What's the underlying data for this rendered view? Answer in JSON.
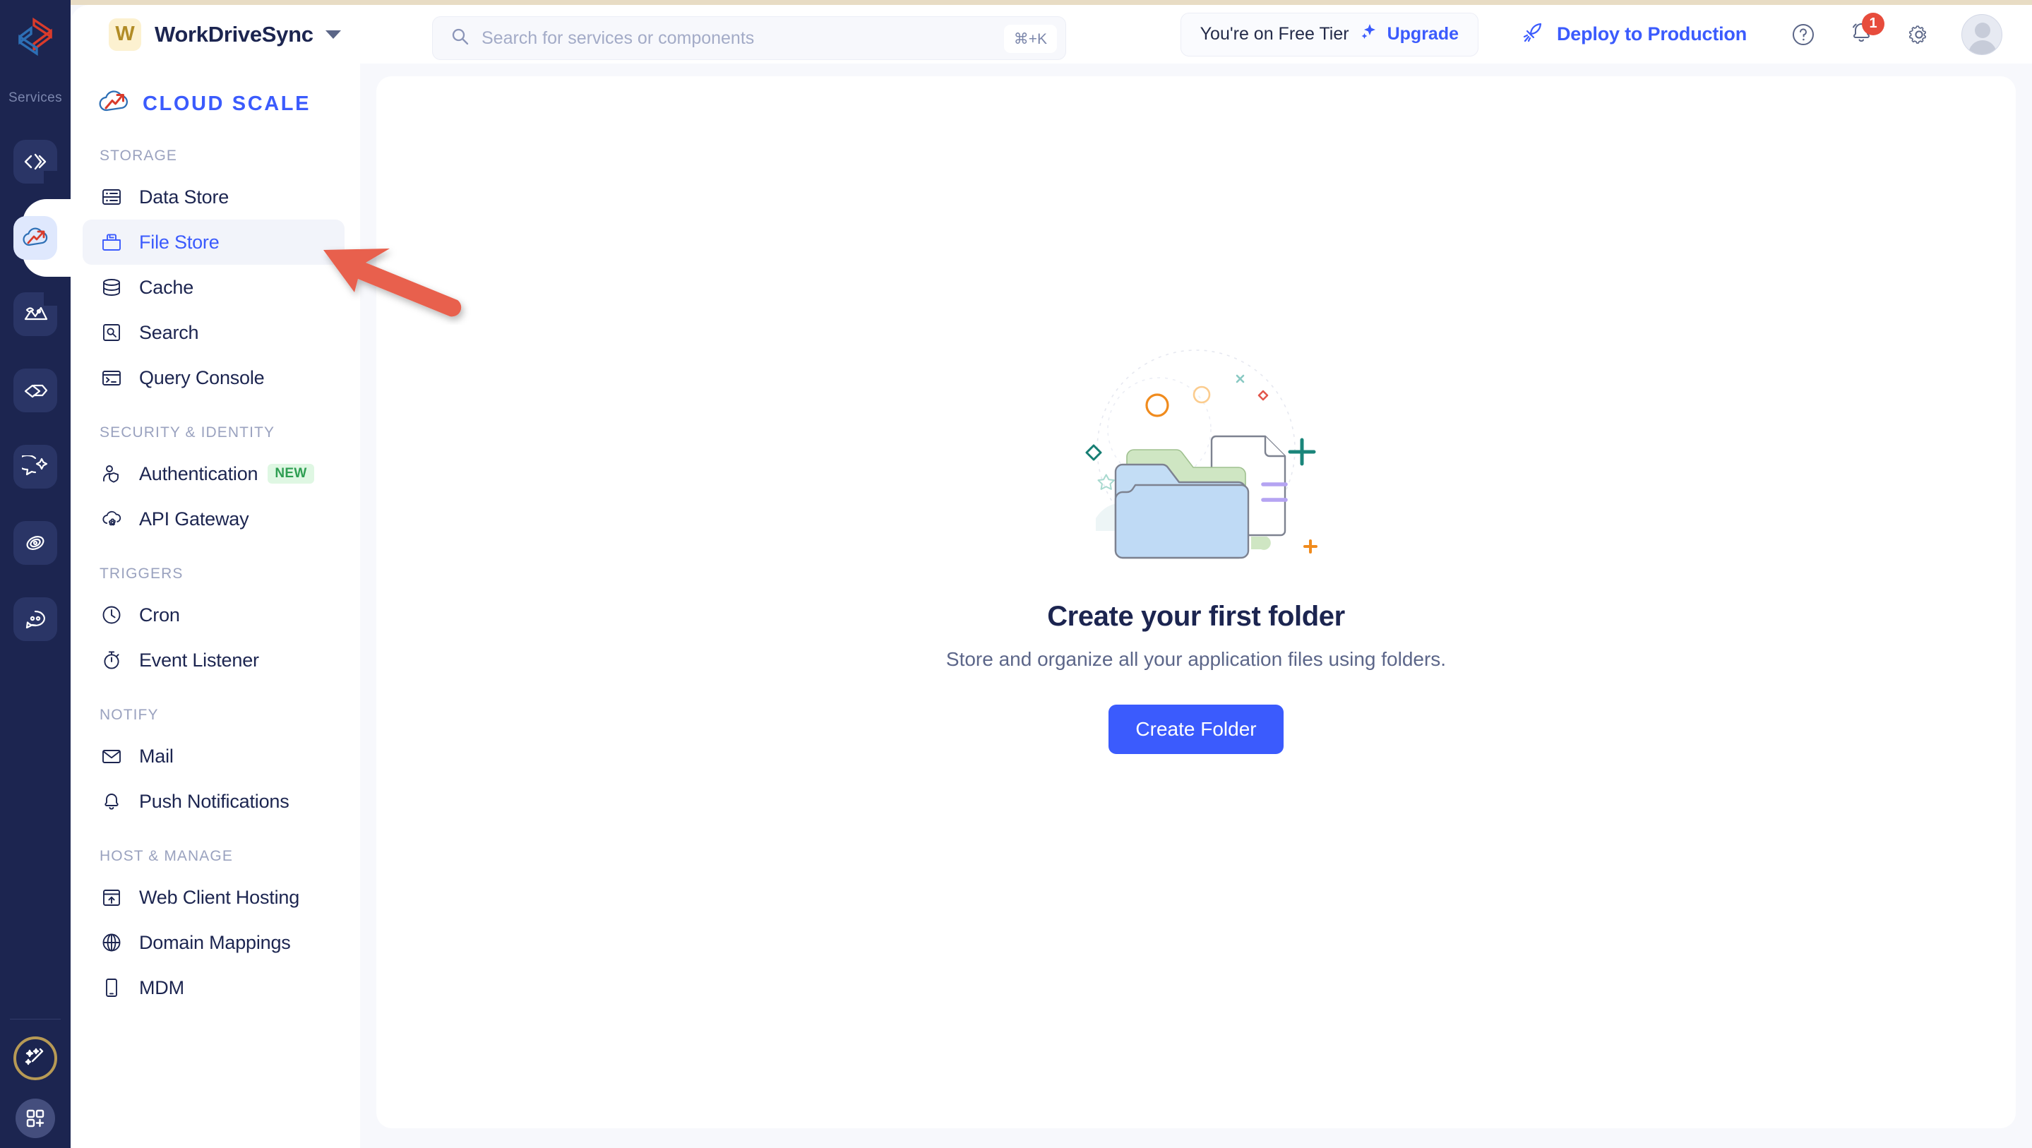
{
  "rail": {
    "services_label": "Services",
    "logo_icon": "zoho-logo-icon",
    "items": [
      {
        "icon": "code-icon",
        "name": "catalyst-code-service"
      },
      {
        "icon": "cloud-scale-icon",
        "name": "cloud-scale-service",
        "active": true
      },
      {
        "icon": "data-visual-icon",
        "name": "data-visual-service"
      },
      {
        "icon": "pipeline-icon",
        "name": "pipeline-service"
      },
      {
        "icon": "chat-sparkle-icon",
        "name": "ai-assist-service"
      },
      {
        "icon": "orbit-icon",
        "name": "orbit-service"
      },
      {
        "icon": "bot-chat-icon",
        "name": "bot-service"
      }
    ],
    "bottom": [
      {
        "icon": "magic-wand-icon",
        "name": "magic-wand-button"
      },
      {
        "icon": "grid-plus-icon",
        "name": "add-app-button"
      }
    ]
  },
  "header": {
    "project_initial": "W",
    "project_name": "WorkDriveSync",
    "project_caret_icon": "chevron-down-icon",
    "search": {
      "placeholder": "Search for services or components",
      "shortcut": "⌘+K",
      "icon": "search-icon"
    },
    "tier_text": "You're on Free Tier",
    "tier_upgrade_label": "Upgrade",
    "tier_spark_icon": "sparkle-icon",
    "deploy_label": "Deploy to Production",
    "deploy_icon": "rocket-icon",
    "help_icon": "help-circle-icon",
    "notifications_icon": "bell-icon",
    "notifications_count": "1",
    "settings_icon": "gear-icon",
    "avatar_icon": "user-avatar"
  },
  "sidebar": {
    "brand": "CLOUD SCALE",
    "brand_icon": "cloud-chart-icon",
    "groups": [
      {
        "title": "STORAGE",
        "items": [
          {
            "label": "Data Store",
            "icon": "database-rows-icon",
            "active": false
          },
          {
            "label": "File Store",
            "icon": "folder-icon",
            "active": true
          },
          {
            "label": "Cache",
            "icon": "cache-stack-icon",
            "active": false
          },
          {
            "label": "Search",
            "icon": "search-square-icon",
            "active": false
          },
          {
            "label": "Query Console",
            "icon": "terminal-icon",
            "active": false
          }
        ]
      },
      {
        "title": "SECURITY & IDENTITY",
        "items": [
          {
            "label": "Authentication",
            "icon": "user-shield-icon",
            "active": false,
            "tag": "NEW"
          },
          {
            "label": "API Gateway",
            "icon": "cloud-gear-icon",
            "active": false
          }
        ]
      },
      {
        "title": "TRIGGERS",
        "items": [
          {
            "label": "Cron",
            "icon": "clock-icon",
            "active": false
          },
          {
            "label": "Event Listener",
            "icon": "stopwatch-icon",
            "active": false
          }
        ]
      },
      {
        "title": "NOTIFY",
        "items": [
          {
            "label": "Mail",
            "icon": "envelope-icon",
            "active": false
          },
          {
            "label": "Push Notifications",
            "icon": "bell-icon",
            "active": false
          }
        ]
      },
      {
        "title": "HOST & MANAGE",
        "items": [
          {
            "label": "Web Client Hosting",
            "icon": "window-upload-icon",
            "active": false
          },
          {
            "label": "Domain Mappings",
            "icon": "globe-icon",
            "active": false
          },
          {
            "label": "MDM",
            "icon": "mobile-device-icon",
            "active": false
          }
        ]
      }
    ]
  },
  "main": {
    "empty_state": {
      "illustration": "folder-and-document-illustration",
      "title": "Create your first folder",
      "subtitle": "Store and organize all your application files using folders.",
      "button_label": "Create Folder"
    }
  },
  "annotation": {
    "arrow_icon": "pointer-arrow-annotation",
    "arrow_color": "#e8604d",
    "points_at": "File Store"
  },
  "colors": {
    "accent": "#3b5bfd",
    "rail_bg": "#1c2550",
    "page_bg": "#f7f8fc",
    "badge_red": "#e74c3c",
    "tag_green": "#2e9e52"
  }
}
